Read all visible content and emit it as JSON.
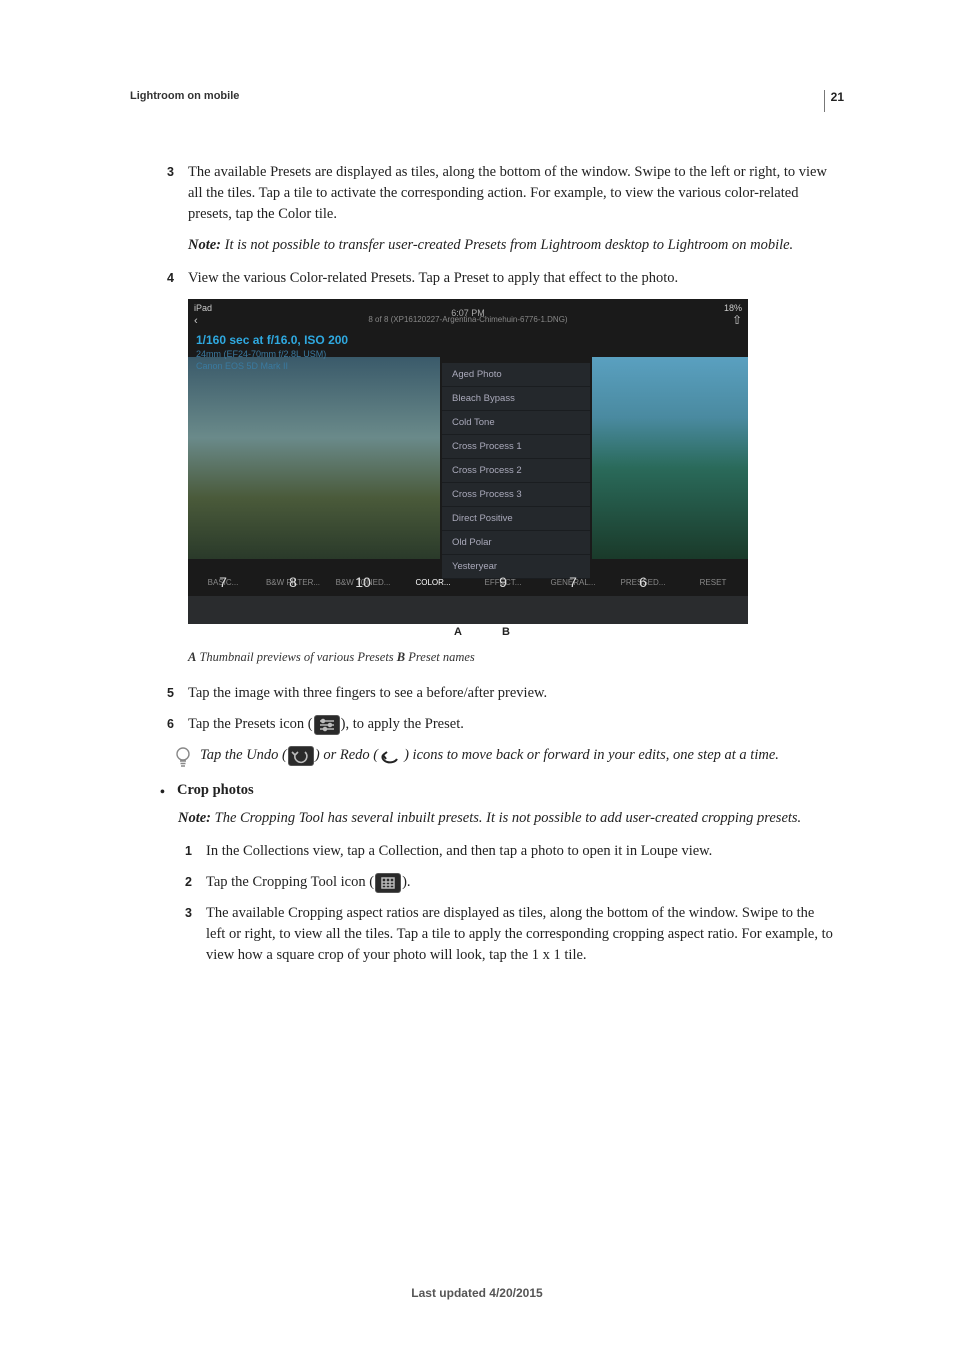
{
  "page_number": "21",
  "breadcrumb": "Lightroom on mobile",
  "steps_top": {
    "3": "The available Presets are displayed as tiles, along the bottom of the window. Swipe to the left or right, to view all the tiles. Tap a tile to activate the corresponding action. For example, to view the various color-related presets, tap the Color tile.",
    "4": "View the various Color-related Presets. Tap a Preset to apply that effect to the photo.",
    "5": "Tap the image with three fingers to see a before/after preview.",
    "6_pre": "Tap the Presets icon (",
    "6_post": "), to apply the Preset."
  },
  "note_transfer": "It is not possible to transfer user-created Presets from Lightroom desktop to Lightroom on mobile.",
  "note_label": "Note: ",
  "screenshot": {
    "device": "iPad",
    "time": "6:07 PM",
    "battery": "18%",
    "title": "8 of 8 (XP16120227-Argentina-Chimehuin-6776-1.DNG)",
    "exif_line1": "1/160 sec at f/16.0, ISO 200",
    "exif_line2": "24mm (EF24-70mm f/2.8L USM)",
    "exif_line3": "Canon EOS 5D Mark II",
    "presets": [
      "Aged Photo",
      "Bleach Bypass",
      "Cold Tone",
      "Cross Process 1",
      "Cross Process 2",
      "Cross Process 3",
      "Direct Positive",
      "Old Polar",
      "Yesteryear"
    ],
    "tabs": [
      "BASIC...",
      "B&W FILTER...",
      "B&W TONED...",
      "COLOR...",
      "EFFECT...",
      "GENERAL...",
      "PRESSED...",
      "RESET"
    ],
    "numbers": [
      "7",
      "8",
      "10",
      "9",
      "7",
      "6"
    ]
  },
  "caption": {
    "A_label": "A",
    "A_text": " Thumbnail previews of various Presets  ",
    "B_label": "B",
    "B_text": " Preset names"
  },
  "tip": {
    "pre": "Tap the Undo (",
    "mid": ") or Redo (",
    "post": ") icons to move back or forward in your edits, one step at a time."
  },
  "crop": {
    "heading": "Crop photos",
    "note": "The Cropping Tool has several inbuilt presets. It is not possible to add user-created cropping presets.",
    "steps": {
      "1": "In the Collections view, tap a Collection, and then tap a photo to open it in Loupe view.",
      "2_pre": "Tap the Cropping Tool icon (",
      "2_post": ").",
      "3": "The available Cropping aspect ratios are displayed as tiles, along the bottom of the window. Swipe to the left or right, to view all the tiles. Tap a tile to apply the corresponding cropping aspect ratio. For example, to view how a square crop of your photo will look, tap the 1 x 1 tile."
    }
  },
  "footer": "Last updated 4/20/2015"
}
